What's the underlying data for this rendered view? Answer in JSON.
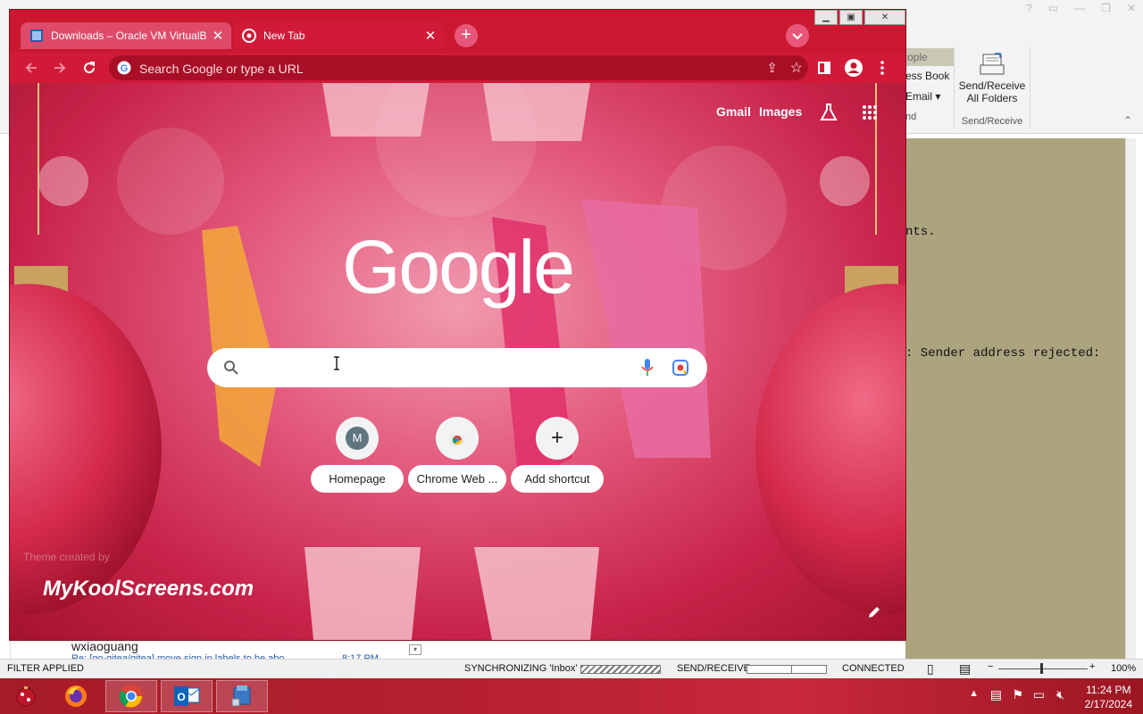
{
  "outlook": {
    "ribbon_items": [
      "ople",
      "ess Book",
      "Email",
      "nd"
    ],
    "send_receive_label_line1": "Send/Receive",
    "send_receive_label_line2": "All Folders",
    "send_receive_group": "Send/Receive",
    "reading_line1": "nts.",
    "reading_line2": ": Sender address rejected:",
    "list_sender": "wxiaoguang",
    "list_subject": "Re: [go-gitea/gitea] move sign in labels to be abo",
    "list_time": "8:17 PM",
    "status": {
      "filter": "FILTER APPLIED",
      "sync": "SYNCHRONIZING  'Inbox'",
      "send_receive": "SEND/RECEIVE",
      "connected": "CONNECTED",
      "zoom": "100%"
    }
  },
  "taskbar": {
    "apps": [
      "start",
      "firefox",
      "chrome",
      "outlook",
      "virtualbox"
    ],
    "time": "11:24 PM",
    "date": "2/17/2024"
  },
  "chrome": {
    "tabs": [
      {
        "title": "Downloads – Oracle VM VirtualB",
        "active": false
      },
      {
        "title": "New Tab",
        "active": true
      }
    ],
    "omnibox_placeholder": "Search Google or type a URL",
    "ntp": {
      "gmail": "Gmail",
      "images": "Images",
      "logo": "Google",
      "shortcuts": [
        {
          "label": "Homepage",
          "initial": "M"
        },
        {
          "label": "Chrome Web ...",
          "initial": ""
        },
        {
          "label": "Add shortcut",
          "initial": "+"
        }
      ],
      "theme_credit": "Theme created by",
      "brand": "MyKoolScreens.com"
    }
  },
  "colors": {
    "chrome_frame": "#c9182f",
    "reading_pane": "#aca47f",
    "taskbar": "#a31b28"
  }
}
